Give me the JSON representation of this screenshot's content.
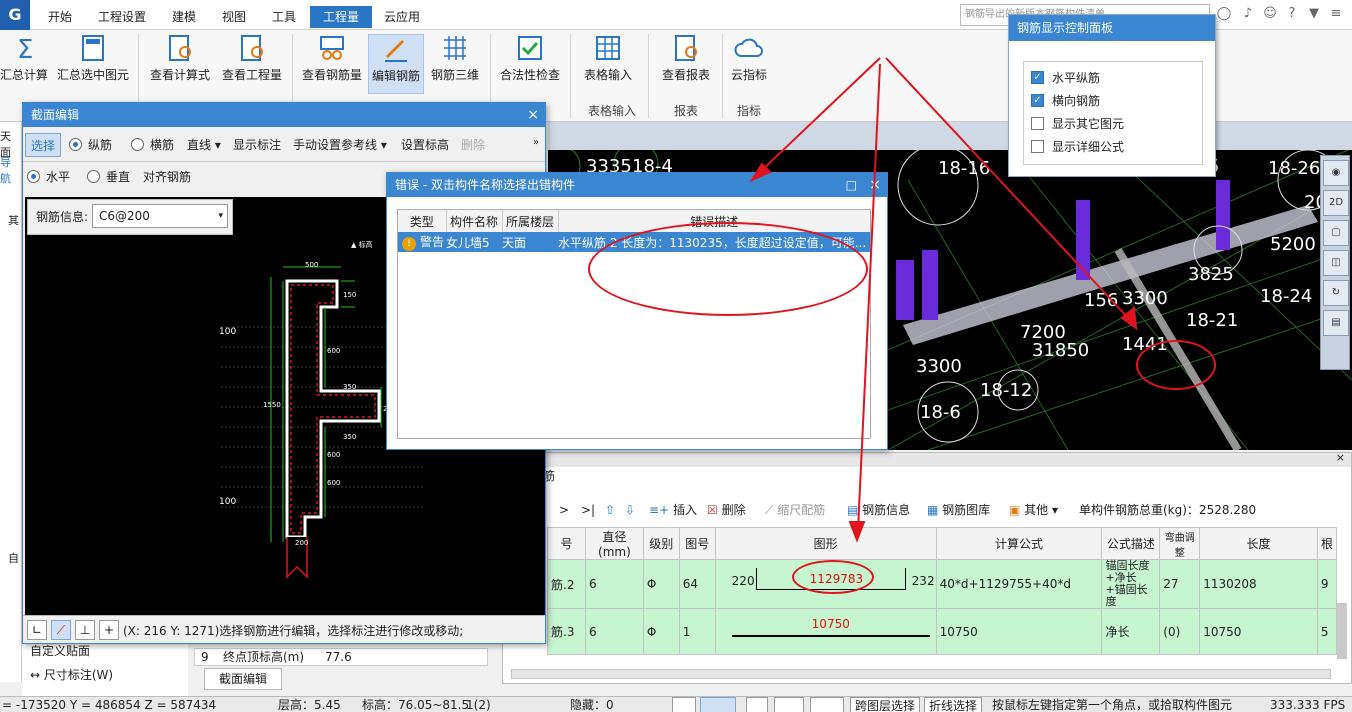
{
  "menu": {
    "logo": "G",
    "tabs": [
      "开始",
      "工程设置",
      "建模",
      "视图",
      "工具",
      "工程量",
      "云应用"
    ],
    "active_tab": "工程量",
    "search_placeholder": "钢筋导出的新版本钢筋构件清单..."
  },
  "ribbon": {
    "buttons": [
      "汇总计算",
      "汇总选中图元",
      "查看计算式",
      "查看工程量",
      "查看钢筋量",
      "编辑钢筋",
      "钢筋三维",
      "合法性检查",
      "表格输入",
      "查看报表",
      "云指标"
    ],
    "groups": [
      "表格输入",
      "报表",
      "指标"
    ]
  },
  "left_tree": {
    "items": [
      "天面",
      "导航",
      "其",
      "自"
    ],
    "bottom_items": [
      "自定义贴面",
      "尺寸标注(W)"
    ],
    "prop_row": {
      "num": "9",
      "label": "终点顶标高(m)",
      "value": "77.6"
    },
    "bottom_tab": "截面编辑"
  },
  "section_edit": {
    "title": "截面编辑",
    "toolbar1": {
      "select": "选择",
      "long": "纵筋",
      "trans": "横筋",
      "line": "直线",
      "show_label": "显示标注",
      "manual_ref": "手动设置参考线",
      "set_elev": "设置标高",
      "delete": "删除"
    },
    "toolbar2": {
      "horizontal": "水平",
      "vertical": "垂直",
      "align": "对齐钢筋"
    },
    "rebar_info_label": "钢筋信息:",
    "rebar_info_value": "C6@200",
    "status_text": "(X: 216 Y: 1271)选择钢筋进行编辑，选择标注进行修改或移动;",
    "dims": [
      "500",
      "150",
      "600",
      "350",
      "200",
      "1550",
      "600",
      "350",
      "600",
      "200",
      "100",
      "100"
    ]
  },
  "error_dialog": {
    "title": "错误 - 双击构件名称选择出错构件",
    "headers": [
      "类型",
      "构件名称",
      "所属楼层",
      "错误描述"
    ],
    "row": {
      "type": "警告",
      "name": "女儿墙5",
      "floor": "天面",
      "desc": "水平纵筋.2 长度为：1130235，长度超过设定值，可能..."
    }
  },
  "control_panel": {
    "title": "钢筋显示控制面板",
    "options": [
      {
        "label": "水平纵筋",
        "checked": true
      },
      {
        "label": "横向钢筋",
        "checked": true
      },
      {
        "label": "显示其它图元",
        "checked": false
      },
      {
        "label": "显示详细公式",
        "checked": false
      }
    ]
  },
  "viewport": {
    "labels": [
      "3335",
      "18-4",
      "18-16",
      "5",
      "18-26",
      "20",
      "5200",
      "3825",
      "18-24",
      "3300",
      "156",
      "18-21",
      "7200",
      "31850",
      "1441",
      "3300",
      "18-12",
      "18-6"
    ],
    "right_tools": [
      "2D"
    ]
  },
  "rebar_table": {
    "tab": "筋",
    "toolbar": {
      "insert": "插入",
      "delete": "删除",
      "scale": "缩尺配筋",
      "info": "钢筋信息",
      "lib": "钢筋图库",
      "other": "其他",
      "total_label": "单构件钢筋总重(kg)：2528.280"
    },
    "headers": [
      "号",
      "直径(mm)",
      "级别",
      "图号",
      "图形",
      "计算公式",
      "公式描述",
      "弯曲调整",
      "长度",
      "根"
    ],
    "rows": [
      {
        "no": "筋.2",
        "dia": "6",
        "grade": "Φ",
        "fig": "64",
        "left": "220",
        "mid": "1129783",
        "right": "232",
        "formula": "40*d+1129755+40*d",
        "desc": "锚固长度+净长+锚固长度",
        "bend": "27",
        "length": "1130208",
        "count": "9"
      },
      {
        "no": "筋.3",
        "dia": "6",
        "grade": "Φ",
        "fig": "1",
        "mid": "10750",
        "formula": "10750",
        "desc": "净长",
        "bend": "(0)",
        "length": "10750",
        "count": "5"
      }
    ]
  },
  "status_bar": {
    "coords": "= -173520 Y = 486854 Z = 587434",
    "floor_height": "层高：5.45",
    "elevation": "标高：76.05~81.5",
    "page": "1(2)",
    "hidden": "隐藏：0",
    "cross_floor": "跨图层选择",
    "polyline": "折线选择",
    "hint": "按鼠标左键指定第一个角点，或拾取构件图元",
    "fps": "333.333 FPS"
  }
}
